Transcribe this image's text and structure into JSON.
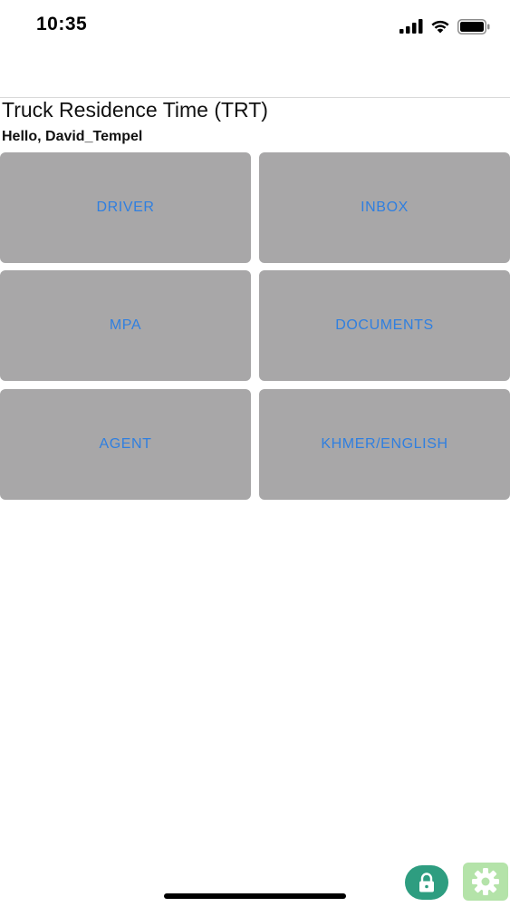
{
  "status_bar": {
    "time": "10:35",
    "icons": [
      "cellular-signal-icon",
      "wifi-icon",
      "battery-icon"
    ]
  },
  "header": {
    "title": "Truck Residence Time (TRT)",
    "greeting": "Hello, David_Tempel"
  },
  "menu": {
    "tiles": [
      {
        "label": "DRIVER"
      },
      {
        "label": "INBOX"
      },
      {
        "label": "MPA"
      },
      {
        "label": "DOCUMENTS"
      },
      {
        "label": "AGENT"
      },
      {
        "label": "KHMER/ENGLISH"
      }
    ]
  },
  "floating_buttons": {
    "lock_icon": "lock-icon",
    "settings_icon": "gear-icon"
  },
  "colors": {
    "tile_background": "#a8a7a8",
    "tile_text": "#2f7fe0",
    "lock_button": "#2e9d80",
    "settings_button": "#b4e3a9"
  }
}
